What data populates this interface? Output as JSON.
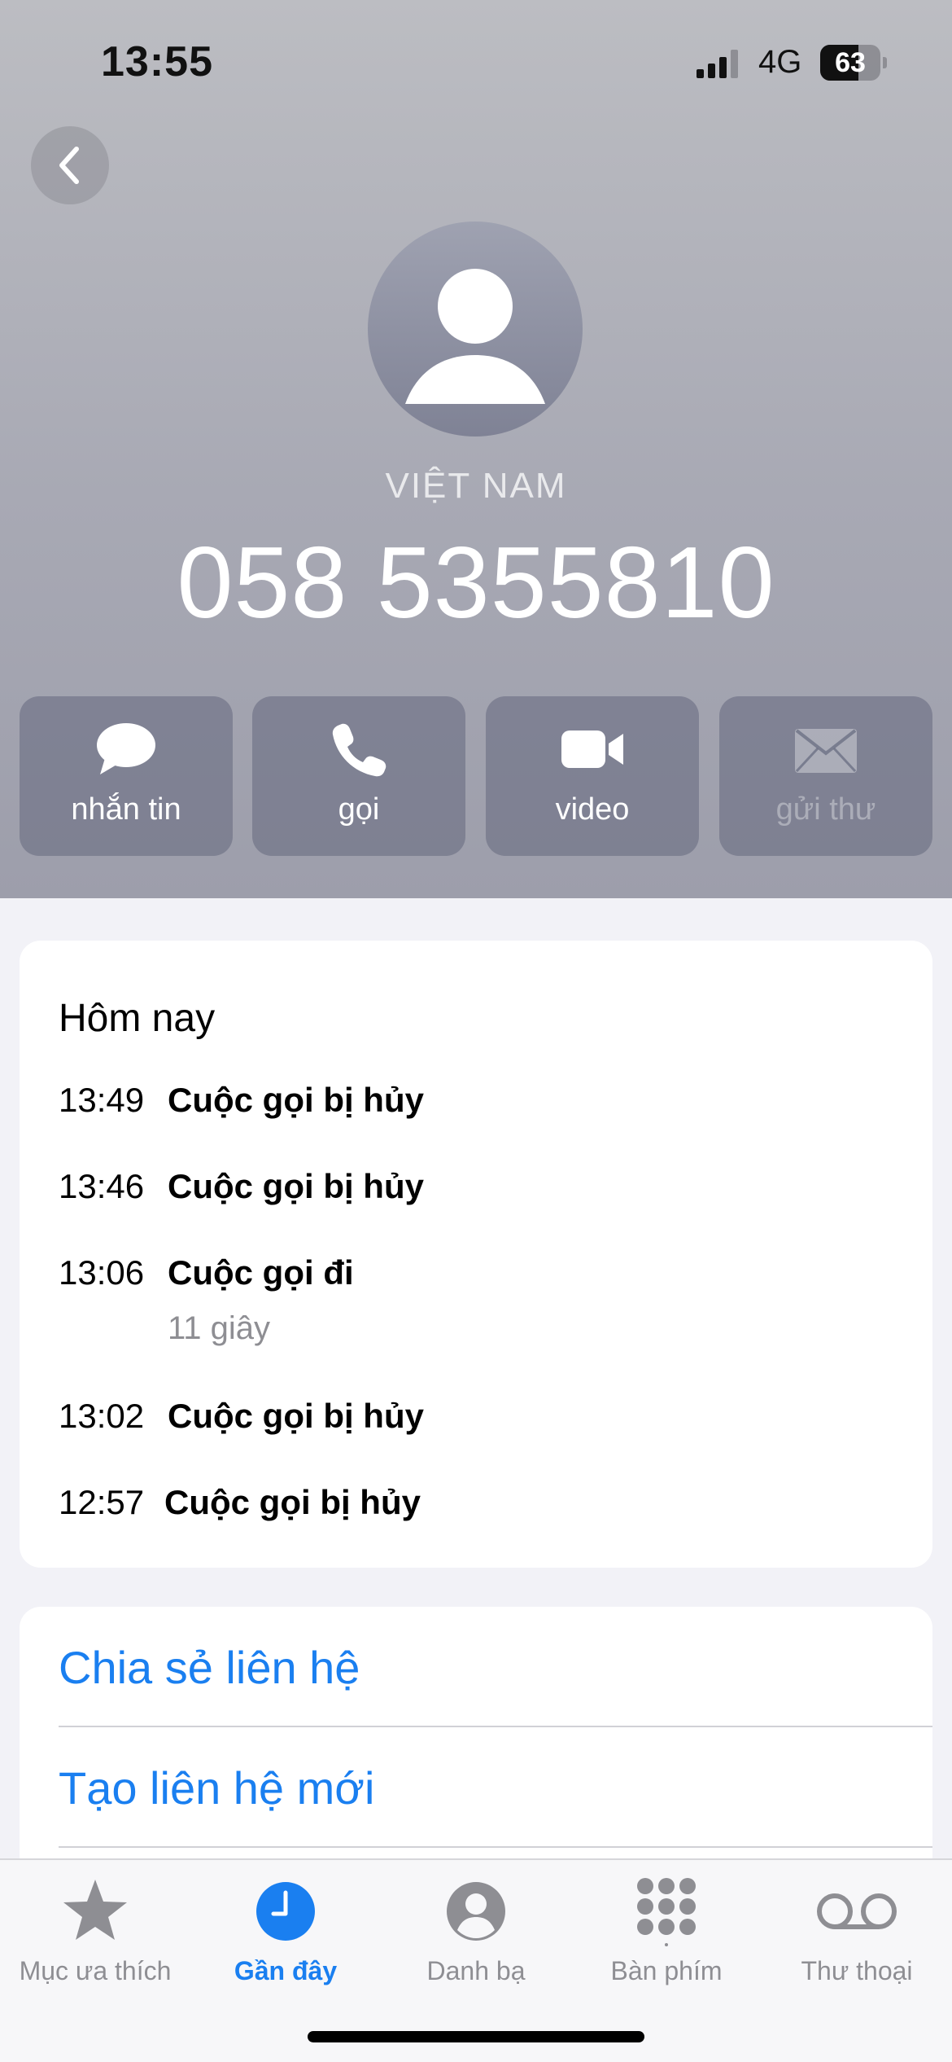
{
  "status_bar": {
    "time": "13:55",
    "network": "4G",
    "battery_level": "63",
    "battery_fraction": 0.63
  },
  "contact": {
    "country": "VIỆT NAM",
    "phone_number": "058 5355810"
  },
  "actions": [
    {
      "label": "nhắn tin",
      "icon": "message-bubble-icon",
      "enabled": true
    },
    {
      "label": "gọi",
      "icon": "phone-icon",
      "enabled": true
    },
    {
      "label": "video",
      "icon": "video-camera-icon",
      "enabled": true
    },
    {
      "label": "gửi thư",
      "icon": "envelope-icon",
      "enabled": false
    }
  ],
  "recents": {
    "section_title": "Hôm nay",
    "calls": [
      {
        "time": "13:49",
        "status": "Cuộc gọi bị hủy"
      },
      {
        "time": "13:46",
        "status": "Cuộc gọi bị hủy"
      },
      {
        "time": "13:06",
        "status": "Cuộc gọi đi",
        "duration": "11 giây"
      },
      {
        "time": "13:02",
        "status": "Cuộc gọi bị hủy"
      },
      {
        "time": "12:57",
        "status": "Cuộc gọi bị hủy"
      }
    ]
  },
  "contact_actions": {
    "share_contact": "Chia sẻ liên hệ",
    "create_new_contact": "Tạo liên hệ mới"
  },
  "tab_bar": {
    "active": "recents",
    "tabs": [
      {
        "id": "favorites",
        "label": "Mục ưa thích",
        "icon": "star-icon"
      },
      {
        "id": "recents",
        "label": "Gần đây",
        "icon": "clock-icon"
      },
      {
        "id": "contacts",
        "label": "Danh bạ",
        "icon": "person-circle-icon"
      },
      {
        "id": "keypad",
        "label": "Bàn phím",
        "icon": "keypad-grid-icon"
      },
      {
        "id": "voicemail",
        "label": "Thư thoại",
        "icon": "voicemail-icon"
      }
    ]
  },
  "colors": {
    "accent_blue": "#1a7ff0",
    "secondary_gray": "#8e8e93"
  }
}
